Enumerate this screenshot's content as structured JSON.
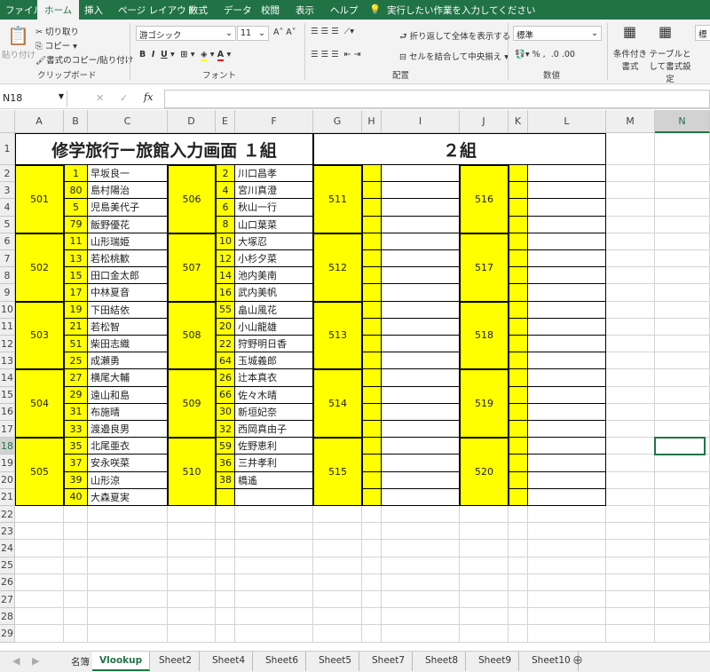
{
  "menu": [
    "ファイル",
    "ホーム",
    "挿入",
    "ページ レイアウト",
    "数式",
    "データ",
    "校閲",
    "表示",
    "ヘルプ"
  ],
  "tell_me": "実行したい作業を入力してください",
  "ribbon": {
    "paste": "貼り付け",
    "cut": "切り取り",
    "copy": "コピー",
    "format_painter": "書式のコピー/貼り付け",
    "clipboard": "クリップボード",
    "font_name": "游ゴシック",
    "font_size": "11",
    "font": "フォント",
    "wrap": "折り返して全体を表示する",
    "merge": "セルを結合して中央揃え",
    "alignment": "配置",
    "number_format": "標準",
    "number": "数値",
    "cond_format": "条件付き書式",
    "table_format": "テーブルとして書式設定",
    "style_partial": "標"
  },
  "formula_bar": {
    "name_box": "N18",
    "formula": ""
  },
  "columns": [
    "A",
    "B",
    "C",
    "D",
    "E",
    "F",
    "G",
    "H",
    "I",
    "J",
    "K",
    "L",
    "M",
    "N"
  ],
  "titles": {
    "group1": "修学旅行ー旅館入力画面 １組",
    "group2": "２組"
  },
  "rooms": [
    {
      "room": "501",
      "members": [
        [
          "1",
          "早坂良一"
        ],
        [
          "80",
          "島村陽治"
        ],
        [
          "5",
          "児島美代子"
        ],
        [
          "79",
          "飯野優花"
        ]
      ]
    },
    {
      "room": "502",
      "members": [
        [
          "11",
          "山形瑞姫"
        ],
        [
          "13",
          "若松桃歓"
        ],
        [
          "15",
          "田口金太郎"
        ],
        [
          "17",
          "中林夏音"
        ]
      ]
    },
    {
      "room": "503",
      "members": [
        [
          "19",
          "下田結依"
        ],
        [
          "21",
          "若松智"
        ],
        [
          "51",
          "柴田志織"
        ],
        [
          "25",
          "成瀬勇"
        ]
      ]
    },
    {
      "room": "504",
      "members": [
        [
          "27",
          "横尾大輔"
        ],
        [
          "29",
          "遠山和島"
        ],
        [
          "31",
          "布施晴"
        ],
        [
          "33",
          "渡邉良男"
        ]
      ]
    },
    {
      "room": "505",
      "members": [
        [
          "35",
          "北尾亜衣"
        ],
        [
          "37",
          "安永咲菜"
        ],
        [
          "39",
          "山形涼"
        ],
        [
          "40",
          "大森夏実"
        ]
      ]
    },
    {
      "room": "506",
      "members": [
        [
          "2",
          "川口昌孝"
        ],
        [
          "4",
          "宮川真澄"
        ],
        [
          "6",
          "秋山一行"
        ],
        [
          "8",
          "山口葉菜"
        ]
      ]
    },
    {
      "room": "507",
      "members": [
        [
          "10",
          "大塚忍"
        ],
        [
          "12",
          "小杉夕菜"
        ],
        [
          "14",
          "池内美南"
        ],
        [
          "16",
          "武内美帆"
        ]
      ]
    },
    {
      "room": "508",
      "members": [
        [
          "55",
          "畠山風花"
        ],
        [
          "20",
          "小山龍雄"
        ],
        [
          "22",
          "狩野明日香"
        ],
        [
          "64",
          "玉城義郎"
        ]
      ]
    },
    {
      "room": "509",
      "members": [
        [
          "26",
          "辻本真衣"
        ],
        [
          "66",
          "佐々木晴"
        ],
        [
          "30",
          "新垣妃奈"
        ],
        [
          "32",
          "西岡真由子"
        ]
      ]
    },
    {
      "room": "510",
      "members": [
        [
          "59",
          "佐野恵利"
        ],
        [
          "36",
          "三井孝利"
        ],
        [
          "38",
          "橋遙"
        ],
        [
          "",
          ""
        ]
      ]
    },
    {
      "room": "511",
      "members": []
    },
    {
      "room": "512",
      "members": []
    },
    {
      "room": "513",
      "members": []
    },
    {
      "room": "514",
      "members": []
    },
    {
      "room": "515",
      "members": []
    },
    {
      "room": "516",
      "members": []
    },
    {
      "room": "517",
      "members": []
    },
    {
      "room": "518",
      "members": []
    },
    {
      "room": "519",
      "members": []
    },
    {
      "room": "520",
      "members": []
    }
  ],
  "selected_cell": "N18",
  "sheets": [
    "名簿",
    "Vlookup",
    "Sheet2",
    "Sheet4",
    "Sheet6",
    "Sheet5",
    "Sheet7",
    "Sheet8",
    "Sheet9",
    "Sheet10"
  ],
  "active_sheet": "Vlookup",
  "colors": {
    "excel_green": "#217346",
    "highlight": "#ffff00"
  }
}
